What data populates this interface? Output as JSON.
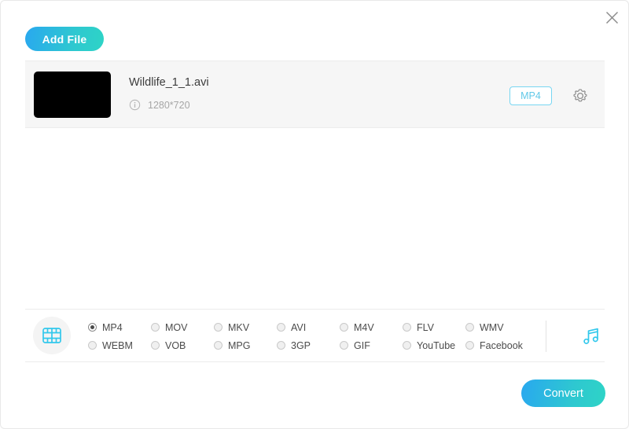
{
  "window": {
    "close_label": "×"
  },
  "toolbar": {
    "add_file_label": "Add File"
  },
  "file_list": {
    "rows": [
      {
        "name": "Wildlife_1_1.avi",
        "resolution": "1280*720",
        "output_format": "MP4",
        "info_icon": "info-circle-icon",
        "settings_icon": "gear-icon",
        "thumbnail_color": "#000000"
      }
    ]
  },
  "format_bar": {
    "media_type_icon": "film-strip-icon",
    "audio_icon": "music-note-icon",
    "selected": "MP4",
    "options": [
      {
        "label": "MP4",
        "selected": true
      },
      {
        "label": "WEBM",
        "selected": false
      },
      {
        "label": "MOV",
        "selected": false
      },
      {
        "label": "VOB",
        "selected": false
      },
      {
        "label": "MKV",
        "selected": false
      },
      {
        "label": "MPG",
        "selected": false
      },
      {
        "label": "AVI",
        "selected": false
      },
      {
        "label": "3GP",
        "selected": false
      },
      {
        "label": "M4V",
        "selected": false
      },
      {
        "label": "GIF",
        "selected": false
      },
      {
        "label": "FLV",
        "selected": false
      },
      {
        "label": "YouTube",
        "selected": false
      },
      {
        "label": "WMV",
        "selected": false
      },
      {
        "label": "Facebook",
        "selected": false
      }
    ]
  },
  "footer": {
    "convert_label": "Convert"
  },
  "colors": {
    "accent_start": "#29a8ef",
    "accent_end": "#2ed4c6",
    "badge_border": "#78d6f2",
    "badge_text": "#61c8e8",
    "icon_cyan": "#32c8ec",
    "row_bg": "#f6f6f6"
  }
}
